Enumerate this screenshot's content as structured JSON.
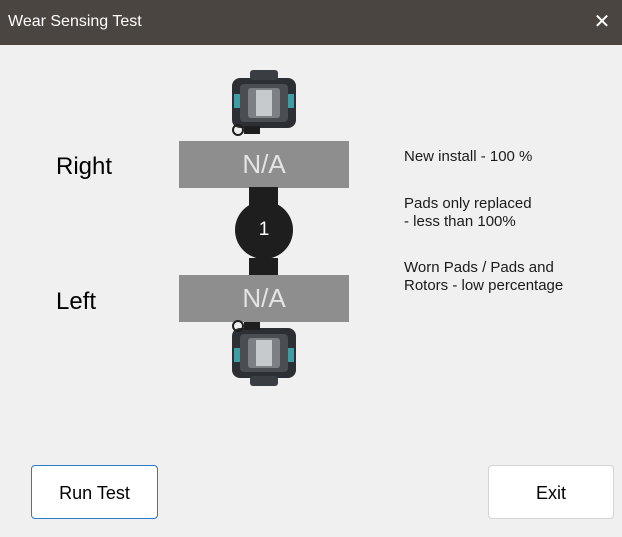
{
  "window": {
    "title": "Wear Sensing Test",
    "close_glyph": "✕"
  },
  "positions": {
    "right": {
      "label": "Right",
      "value": "N/A"
    },
    "left": {
      "label": "Left",
      "value": "N/A"
    }
  },
  "axle": {
    "number": "1"
  },
  "legend": {
    "line1": "New install - 100 %",
    "line2a": "Pads only replaced",
    "line2b": "- less than 100%",
    "line3a": "Worn Pads / Pads and",
    "line3b": "Rotors - low percentage"
  },
  "buttons": {
    "run_test": "Run Test",
    "exit": "Exit"
  },
  "colors": {
    "titlebar": "#4a4540",
    "value_box": "#8e8e8e",
    "axle": "#1e1e1e",
    "primary_border": "#2b79c9"
  },
  "icons": {
    "close": "close-icon",
    "caliper": "brake-caliper-icon"
  }
}
